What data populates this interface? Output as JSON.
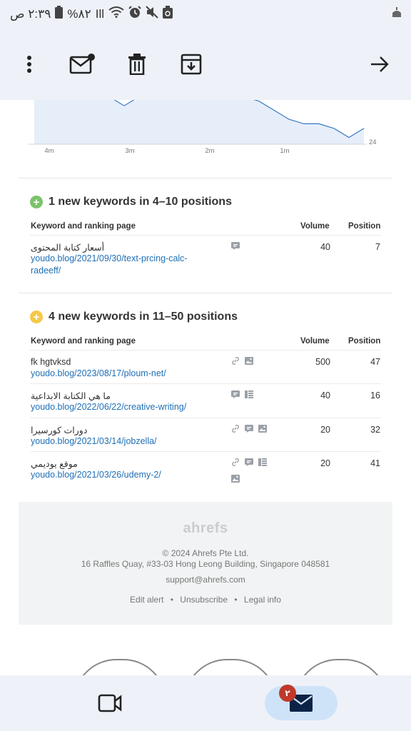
{
  "status_bar": {
    "time": "٢:٣٩ ص",
    "battery": "%٨٢",
    "signal": "Ill"
  },
  "toolbar": {
    "more_icon": "more-vertical-icon",
    "mark_unread_icon": "mail-unread-icon",
    "delete_icon": "trash-icon",
    "archive_icon": "archive-icon",
    "forward_icon": "arrow-right-icon"
  },
  "chart_data": {
    "type": "line",
    "x_ticks": [
      "4m",
      "3m",
      "2m",
      "1m"
    ],
    "y_tick": "24",
    "series": [
      {
        "values": [
          14,
          14,
          14,
          14,
          14,
          14,
          16,
          14,
          14,
          14,
          14,
          14,
          14,
          14,
          14,
          15,
          17,
          19,
          20,
          20,
          21,
          23,
          21
        ]
      }
    ]
  },
  "section1": {
    "title": "1 new keywords in 4–10 positions",
    "headers": {
      "keyword": "Keyword and ranking page",
      "volume": "Volume",
      "position": "Position"
    },
    "rows": [
      {
        "keyword": "أسعار كتابة المحتوى",
        "url_line1": "youdo.blog/2021/09/30/text-prcing-calc-",
        "url_line2": "radeeff/",
        "volume": "40",
        "position": "7"
      }
    ]
  },
  "section2": {
    "title": "4 new keywords in 11–50 positions",
    "headers": {
      "keyword": "Keyword and ranking page",
      "volume": "Volume",
      "position": "Position"
    },
    "rows": [
      {
        "keyword": "fk hgtvksd",
        "url": "youdo.blog/2023/08/17/ploum-net/",
        "volume": "500",
        "position": "47"
      },
      {
        "keyword": "ما هي الكتابة الابداعية",
        "url": "youdo.blog/2022/06/22/creative-writing/",
        "volume": "40",
        "position": "16"
      },
      {
        "keyword": "دورات كورسيرا",
        "url": "youdo.blog/2021/03/14/jobzella/",
        "volume": "20",
        "position": "32"
      },
      {
        "keyword": "موقع يوديمي",
        "url": "youdo.blog/2021/03/26/udemy-2/",
        "volume": "20",
        "position": "41"
      }
    ]
  },
  "footer": {
    "logo": "ahrefs",
    "copyright": "© 2024 Ahrefs Pte Ltd.",
    "address": "16 Raffles Quay, #33-03 Hong Leong Building, Singapore 048581",
    "email": "support@ahrefs.com",
    "links": [
      "Edit alert",
      "Unsubscribe",
      "Legal info"
    ],
    "separator": "•"
  },
  "bottom_nav": {
    "mail_badge": "٢"
  },
  "colors": {
    "accent_link": "#1f6fb5",
    "chart_line": "#3b78c4",
    "chart_fill": "#e6eefa",
    "badge_green": "#7cc36a",
    "badge_yellow": "#f5c84a"
  }
}
